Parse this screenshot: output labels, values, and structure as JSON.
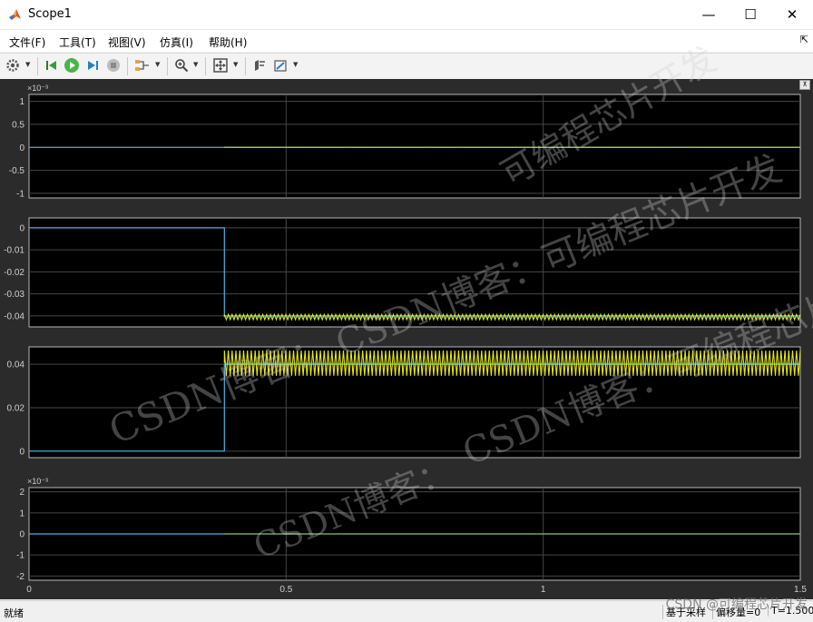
{
  "window": {
    "title": "Scope1",
    "minimize_glyph": "—",
    "maximize_glyph": "☐",
    "close_glyph": "✕"
  },
  "menu": {
    "items": [
      "文件(F)",
      "工具(T)",
      "视图(V)",
      "仿真(I)",
      "帮助(H)"
    ],
    "pin": "⇱"
  },
  "toolbar": {
    "icons": [
      "gear-icon",
      "step-back-icon",
      "run-icon",
      "step-forward-icon",
      "stop-icon",
      "signal-selector-icon",
      "zoom-icon",
      "fit-axes-icon",
      "cursor-measure-icon",
      "style-icon"
    ]
  },
  "chart_data": [
    {
      "type": "line",
      "exponent": "×10⁻³",
      "yticks": [
        "1",
        "0.5",
        "0",
        "-0.5",
        "-1"
      ],
      "ylim": [
        -1.1,
        1.15
      ],
      "series": [
        {
          "color": "#4db2e6",
          "kind": "flat",
          "x": [
            0,
            1.5
          ],
          "y": [
            0,
            0
          ]
        },
        {
          "color": "#e6e61a",
          "kind": "oscillation",
          "start": 0.38,
          "amplitude": 0.00088,
          "offset": -2e-05,
          "cycles": 150
        }
      ]
    },
    {
      "type": "line",
      "yticks": [
        "0",
        "-0.01",
        "-0.02",
        "-0.03",
        "-0.04"
      ],
      "ylim": [
        -0.045,
        0.0045
      ],
      "series": [
        {
          "color": "#4db2e6",
          "kind": "step",
          "x": [
            0,
            0.38,
            0.38,
            1.5
          ],
          "y": [
            0,
            0,
            -0.04,
            -0.04
          ]
        },
        {
          "color": "#e6e61a",
          "kind": "oscillation",
          "start": 0.38,
          "amplitude": 0.0012,
          "offset": -0.0405,
          "cycles": 150
        }
      ]
    },
    {
      "type": "line",
      "yticks": [
        "0.04",
        "0.02",
        "0"
      ],
      "ylim": [
        -0.003,
        0.048
      ],
      "series": [
        {
          "color": "#4db2e6",
          "kind": "step",
          "x": [
            0,
            0.38,
            0.38,
            1.5
          ],
          "y": [
            0,
            0,
            0.04,
            0.04
          ]
        },
        {
          "color": "#e6e61a",
          "kind": "oscillation",
          "start": 0.38,
          "amplitude": 0.0058,
          "offset": 0.0405,
          "cycles": 150
        }
      ]
    },
    {
      "type": "line",
      "exponent": "×10⁻³",
      "yticks": [
        "2",
        "1",
        "0",
        "-1",
        "-2"
      ],
      "ylim": [
        -2.2,
        2.2
      ],
      "xticks": [
        "0",
        "0.5",
        "1",
        "1.5"
      ],
      "xlim": [
        0,
        1.5
      ],
      "series": [
        {
          "color": "#4db2e6",
          "kind": "flat",
          "x": [
            0,
            1.5
          ],
          "y": [
            0,
            0
          ]
        },
        {
          "color": "#e6e61a",
          "kind": "oscillation",
          "start": 0.38,
          "amplitude": 0.0019,
          "offset": -0.0001,
          "cycles": 150
        }
      ]
    }
  ],
  "watermarks": [
    "可编程芯片开发",
    "CSDN博客：可编程芯片开发",
    "CSDN博客：可编程芯片开发",
    "CSDN博客：",
    "CSDN博客："
  ],
  "status": {
    "left": "就绪",
    "sample": "基于采样",
    "offset": "偏移量=0",
    "time": "T=1.500"
  },
  "footer": "CSDN @可编程芯片开发"
}
